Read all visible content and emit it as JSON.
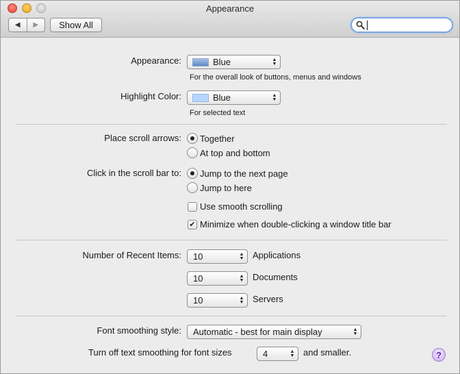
{
  "window": {
    "title": "Appearance"
  },
  "toolbar": {
    "back_glyph": "◀",
    "forward_glyph": "▶",
    "show_all_label": "Show All",
    "search_value": ""
  },
  "appearance": {
    "label": "Appearance:",
    "selected": "Blue",
    "note": "For the overall look of buttons, menus and windows"
  },
  "highlight": {
    "label": "Highlight Color:",
    "selected": "Blue",
    "note": "For selected text"
  },
  "scroll_arrows": {
    "label": "Place scroll arrows:",
    "options": [
      "Together",
      "At top and bottom"
    ],
    "selected_index": 0
  },
  "scroll_click": {
    "label": "Click in the scroll bar to:",
    "options": [
      "Jump to the next page",
      "Jump to here"
    ],
    "selected_index": 0
  },
  "checkboxes": {
    "smooth_scrolling": {
      "label": "Use smooth scrolling",
      "checked": false
    },
    "minimize_dblclick": {
      "label": "Minimize when double-clicking a window title bar",
      "checked": true
    }
  },
  "recent_items": {
    "label": "Number of Recent Items:",
    "applications": {
      "value": "10",
      "label": "Applications"
    },
    "documents": {
      "value": "10",
      "label": "Documents"
    },
    "servers": {
      "value": "10",
      "label": "Servers"
    }
  },
  "font_smoothing": {
    "label": "Font smoothing style:",
    "selected": "Automatic - best for main display"
  },
  "text_smoothing": {
    "label": "Turn off text smoothing for font sizes",
    "value": "4",
    "suffix": "and smaller."
  },
  "help": {
    "glyph": "?"
  },
  "colors": {
    "accent_focus": "#7ea6e0",
    "help_purple": "#5a2aa0",
    "swatch_blue": "#5d88c6",
    "swatch_light": "#b7d6ff"
  }
}
